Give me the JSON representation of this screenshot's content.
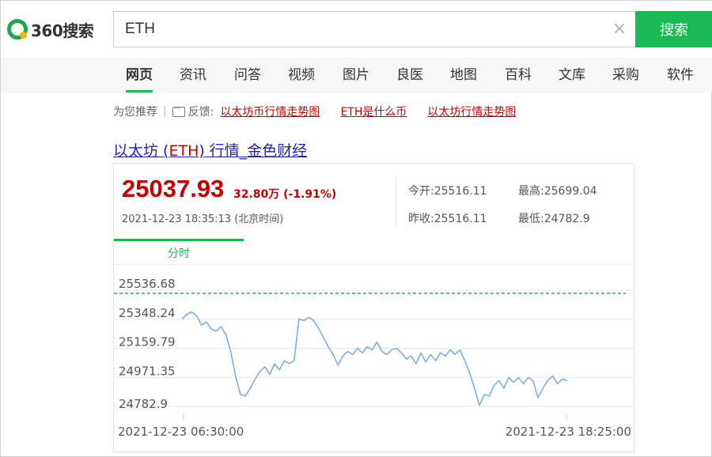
{
  "logo": {
    "text": "360搜索"
  },
  "search": {
    "value": "ETH",
    "button_label": "搜索",
    "clear_symbol": "×"
  },
  "nav": {
    "items": [
      {
        "label": "网页",
        "active": true
      },
      {
        "label": "资讯"
      },
      {
        "label": "问答"
      },
      {
        "label": "视频"
      },
      {
        "label": "图片"
      },
      {
        "label": "良医"
      },
      {
        "label": "地图"
      },
      {
        "label": "百科"
      },
      {
        "label": "文库"
      },
      {
        "label": "采购"
      },
      {
        "label": "软件"
      }
    ]
  },
  "recommend": {
    "prefix": "为您推荐",
    "separator": "|",
    "feedback": "反馈:",
    "links": [
      "以太坊币行情走势图",
      "ETH是什么币",
      "以太坊行情走势图"
    ]
  },
  "result": {
    "title_before": "以太坊 (",
    "title_keyword": "ETH",
    "title_after": ") 行情_金色财经"
  },
  "quote": {
    "price": "25037.93",
    "change": "32.80万 (-1.91%)",
    "timestamp": "2021-12-23 18:35:13 (北京时间)",
    "open": "今开:25516.11",
    "high": "最高:25699.04",
    "prev_close": "昨收:25516.11",
    "low": "最低:24782.9",
    "tab_label": "分时"
  },
  "colors": {
    "accent": "#19b955",
    "price_red": "#c40000",
    "line_blue": "#7aaee8",
    "link_red": "#cc0000"
  },
  "chart_data": {
    "type": "line",
    "x_start_label": "2021-12-23 06:30:00",
    "x_end_label": "2021-12-23 18:25:00",
    "y_tick_labels": [
      "25536.68",
      "25348.24",
      "25159.79",
      "24971.35",
      "24782.9"
    ],
    "ylim": [
      24782.9,
      25536.68
    ],
    "reference_line": 25516.11,
    "series": [
      {
        "values": [
          25348,
          25380,
          25395,
          25372,
          25310,
          25330,
          25285,
          25270,
          25300,
          25250,
          25140,
          24980,
          24860,
          24850,
          24900,
          24960,
          25010,
          25040,
          24990,
          25060,
          25020,
          25080,
          25060,
          25080,
          25350,
          25340,
          25360,
          25340,
          25290,
          25230,
          25170,
          25120,
          25050,
          25110,
          25140,
          25120,
          25160,
          25130,
          25170,
          25150,
          25200,
          25140,
          25120,
          25150,
          25160,
          25130,
          25090,
          25110,
          25060,
          25130,
          25070,
          25120,
          25080,
          25130,
          25110,
          25150,
          25120,
          25150,
          25080,
          25000,
          24900,
          24790,
          24860,
          24850,
          24920,
          24950,
          24900,
          24970,
          24940,
          24970,
          24930,
          24970,
          24950,
          24840,
          24900,
          24950,
          24980,
          24930,
          24960,
          24950
        ]
      }
    ]
  }
}
